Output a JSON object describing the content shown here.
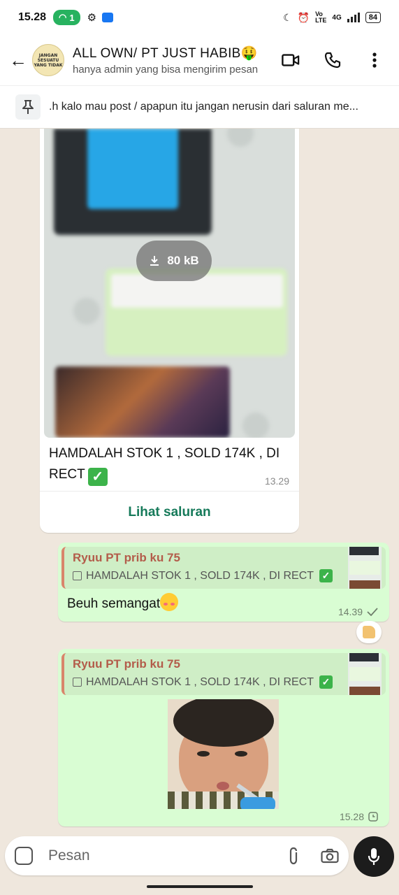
{
  "status": {
    "time": "15.28",
    "hotspot_count": "1",
    "battery": "84",
    "network": "4G"
  },
  "header": {
    "title": "ALL OWN/ PT JUST HABIB🤑",
    "subtitle": "hanya admin yang bisa mengirim pesan",
    "avatar_text": [
      "JANGAN",
      "SESUATU",
      "YANG TIDAK"
    ]
  },
  "pinned": {
    "text": ".h kalo mau post / apapun itu jangan nerusin dari saluran me..."
  },
  "forward": {
    "download_size": "80 kB",
    "caption": "HAMDALAH STOK 1 , SOLD 174K , DI RECT",
    "time": "13.29",
    "view_channel": "Lihat saluran"
  },
  "messages": [
    {
      "quote_name": "Ryuu PT prib ku 75",
      "quote_text": "HAMDALAH STOK 1 , SOLD 174K , DI RECT",
      "text": "Beuh semangat",
      "time": "14.39"
    },
    {
      "quote_name": "Ryuu PT prib ku 75",
      "quote_text": "HAMDALAH STOK 1 , SOLD 174K , DI RECT",
      "time": "15.28"
    }
  ],
  "input": {
    "placeholder": "Pesan"
  },
  "colors": {
    "accent": "#167a5a",
    "bubble_out": "#d9fdd3",
    "quote_bar": "#d9856b",
    "chat_bg": "#efe7dd"
  }
}
